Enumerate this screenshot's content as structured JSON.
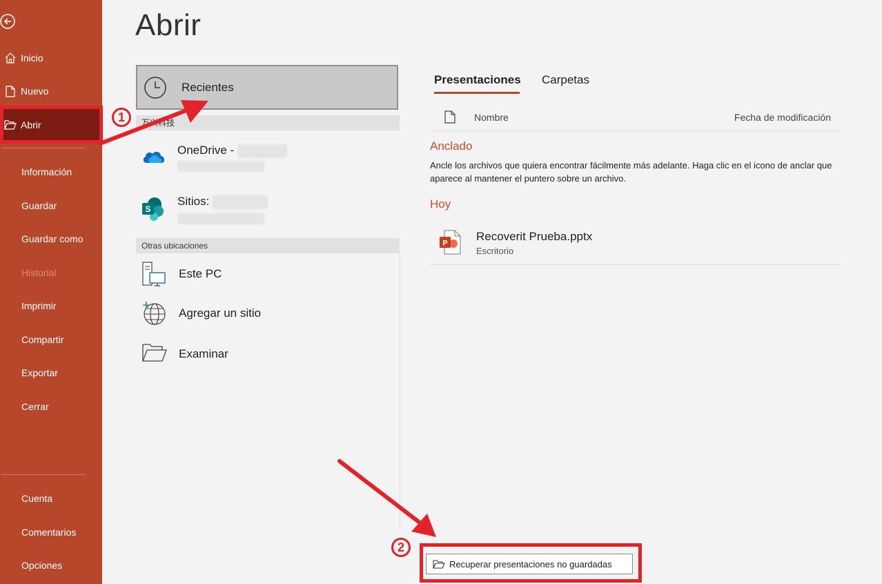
{
  "sidebar": {
    "items": [
      {
        "label": "Inicio"
      },
      {
        "label": "Nuevo"
      },
      {
        "label": "Abrir"
      },
      {
        "label": "Información"
      },
      {
        "label": "Guardar"
      },
      {
        "label": "Guardar como"
      },
      {
        "label": "Historial"
      },
      {
        "label": "Imprimir"
      },
      {
        "label": "Compartir"
      },
      {
        "label": "Exportar"
      },
      {
        "label": "Cerrar"
      },
      {
        "label": "Cuenta"
      },
      {
        "label": "Comentarios"
      },
      {
        "label": "Opciones"
      }
    ]
  },
  "page": {
    "title": "Abrir"
  },
  "locations": {
    "recent": "Recientes",
    "section_cloud": "万兴科技",
    "onedrive": "OneDrive -",
    "sites": "Sitios:",
    "section_other": "Otras ubicaciones",
    "this_pc": "Este PC",
    "add_site": "Agregar un sitio",
    "browse": "Examinar"
  },
  "tabs": [
    {
      "label": "Presentaciones"
    },
    {
      "label": "Carpetas"
    }
  ],
  "columns": {
    "name": "Nombre",
    "modified": "Fecha de modificación"
  },
  "pinned": {
    "title": "Anclado",
    "description": "Ancle los archivos que quiera encontrar fácilmente más adelante. Haga clic en el icono de anclar que aparece al mantener el puntero sobre un archivo."
  },
  "today": {
    "title": "Hoy",
    "files": [
      {
        "name": "Recoverit Prueba.pptx",
        "location": "Escritorio"
      }
    ]
  },
  "recover_button": "Recuperar presentaciones no guardadas",
  "annotations": {
    "step1": "1",
    "step2": "2"
  },
  "colors": {
    "accent": "#b7472a",
    "active": "#7c1c12",
    "annotation": "#e2232a"
  }
}
